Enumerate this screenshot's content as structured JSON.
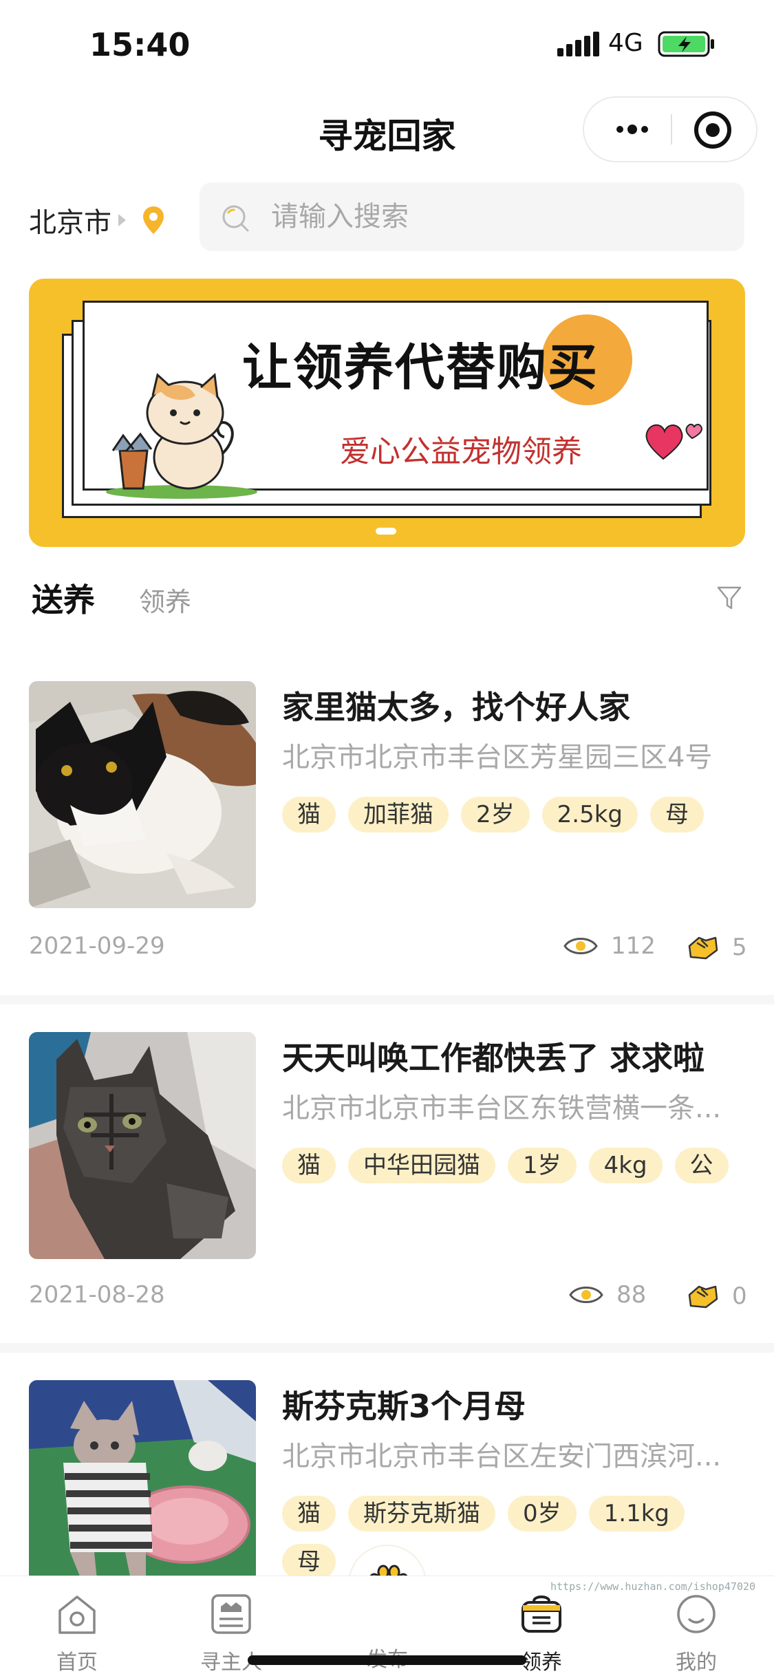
{
  "status_bar": {
    "time": "15:40",
    "network": "4G"
  },
  "nav": {
    "title": "寻宠回家"
  },
  "location": {
    "city": "北京市"
  },
  "search": {
    "placeholder": "请输入搜索"
  },
  "banner": {
    "title": "让领养代替购买",
    "subtitle": "爱心公益宠物领养"
  },
  "tabs": {
    "send": "送养",
    "adopt": "领养"
  },
  "posts": [
    {
      "title": "家里猫太多，找个好人家",
      "address": "北京市北京市丰台区芳星园三区4号",
      "tags": [
        "猫",
        "加菲猫",
        "2岁",
        "2.5kg",
        "母"
      ],
      "date": "2021-09-29",
      "views": "112",
      "likes": "5"
    },
    {
      "title": "天天叫唤工作都快丢了 求求啦",
      "address": "北京市北京市丰台区东铁营横一条...",
      "tags": [
        "猫",
        "中华田园猫",
        "1岁",
        "4kg",
        "公"
      ],
      "date": "2021-08-28",
      "views": "88",
      "likes": "0"
    },
    {
      "title": "斯芬克斯3个月母",
      "address": "北京市北京市丰台区左安门西滨河...",
      "tags": [
        "猫",
        "斯芬克斯猫",
        "0岁",
        "1.1kg",
        "母"
      ]
    }
  ],
  "tabbar": {
    "home": "首页",
    "find_owner": "寻主人",
    "publish": "发布",
    "adopt": "领养",
    "mine": "我的"
  },
  "watermark": "https://www.huzhan.com/ishop47020",
  "colors": {
    "accent": "#f6c02b",
    "tag_bg": "#fdf0c7",
    "muted": "#a8a8a8"
  }
}
